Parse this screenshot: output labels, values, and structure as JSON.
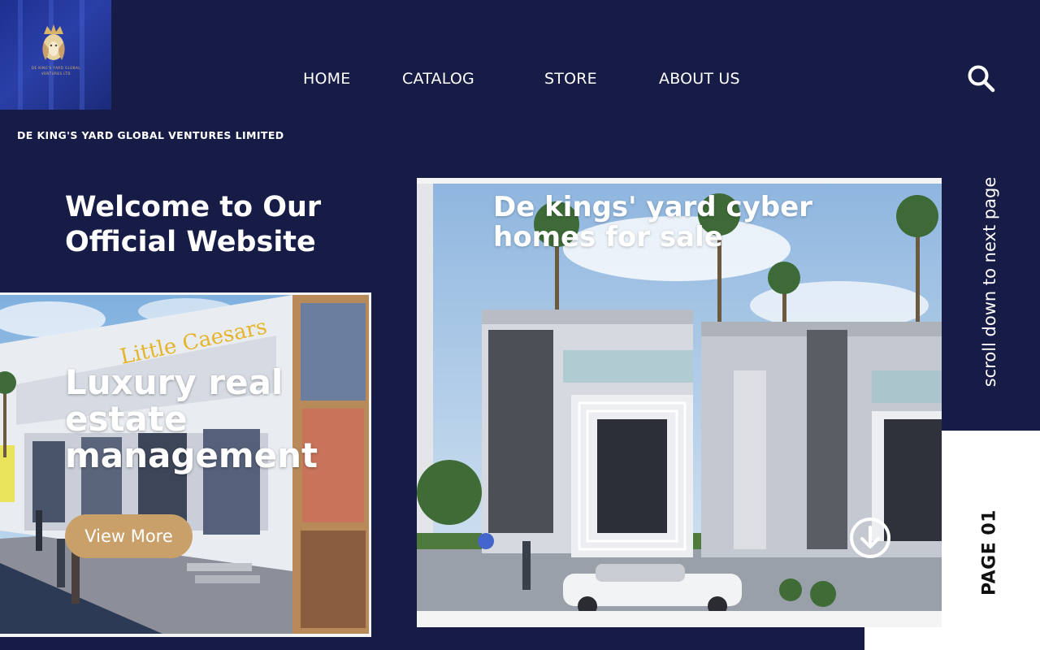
{
  "brand": {
    "logo_icon": "lion-crown-icon",
    "logo_text": "DE KING'S YARD GLOBAL VENTURES LTD",
    "company_name": "DE KING'S YARD GLOBAL VENTURES LIMITED",
    "logo_gold": "#d9b56a"
  },
  "nav": {
    "items": [
      {
        "label": "HOME"
      },
      {
        "label": "CATALOG"
      },
      {
        "label": "STORE"
      },
      {
        "label": "ABOUT US"
      }
    ],
    "search_icon": "search-icon"
  },
  "hero": {
    "welcome": "Welcome to Our Official Website",
    "title": "Luxury real estate management",
    "button_label": "View More",
    "button_color": "#c9a06a"
  },
  "feature": {
    "title": "De kings' yard cyber homes for sale",
    "down_icon": "arrow-down-circle-icon"
  },
  "sidebar": {
    "scroll_hint": "scroll down to next page",
    "page_label": "PAGE 01"
  },
  "theme": {
    "background": "#171c47",
    "text": "#ffffff"
  }
}
